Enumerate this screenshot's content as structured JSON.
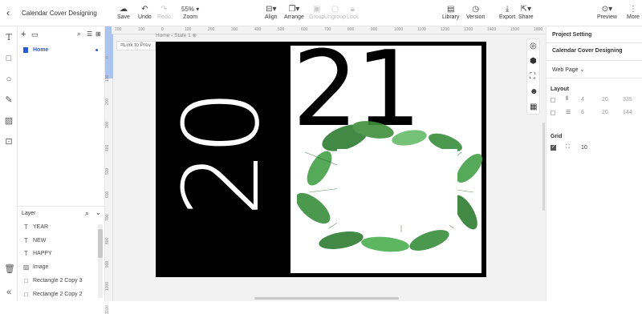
{
  "app": {
    "title": "Calendar Cover Designing"
  },
  "toolbar": {
    "save": "Save",
    "undo": "Undo",
    "redo": "Redo",
    "zoom_value": "55%",
    "zoom_label": "Zoom",
    "align": "Align",
    "arrange": "Arrange",
    "group": "Group",
    "ungroup": "Ungroup",
    "lock": "Lock",
    "library": "Library",
    "version": "Version",
    "export": "Export",
    "share": "Share",
    "preview": "Preview",
    "more": "More"
  },
  "pages": {
    "items": [
      {
        "label": "Home"
      }
    ]
  },
  "layers": {
    "title": "Layer",
    "items": [
      {
        "label": "YEAR",
        "icon": "text-icon"
      },
      {
        "label": "NEW",
        "icon": "text-icon"
      },
      {
        "label": "HAPPY",
        "icon": "text-icon"
      },
      {
        "label": "Image",
        "icon": "image-icon"
      },
      {
        "label": "Rectangle 2 Copy 3",
        "icon": "rectangle-icon"
      },
      {
        "label": "Rectangle 2 Copy 2",
        "icon": "rectangle-icon"
      }
    ]
  },
  "canvas": {
    "state_label": "Home - State 1",
    "link_label": "Link to Prev",
    "text_left": "20",
    "text_right": "21",
    "ruler_top": [
      "200",
      "100",
      "0",
      "100",
      "200",
      "300",
      "400",
      "500",
      "600",
      "700",
      "800",
      "900",
      "1000",
      "1100",
      "1200",
      "1300",
      "1400",
      "1500",
      "1600"
    ],
    "ruler_left": [
      "0",
      "100",
      "200",
      "300",
      "400",
      "500",
      "600",
      "700",
      "800",
      "900",
      "1000",
      "1100"
    ]
  },
  "right_panel": {
    "tab": "Project Setting",
    "project_name": "Calendar Cover Designing",
    "device": "Web Page",
    "layout_label": "Layout",
    "layout_row1": [
      "4",
      "20",
      "335"
    ],
    "layout_row2": [
      "6",
      "20",
      "144"
    ],
    "grid_label": "Grid",
    "grid_value": "10"
  },
  "colors": {
    "accent": "#2a5bd7",
    "poster_black": "#000000",
    "leaf_green": "#2e7d32"
  }
}
